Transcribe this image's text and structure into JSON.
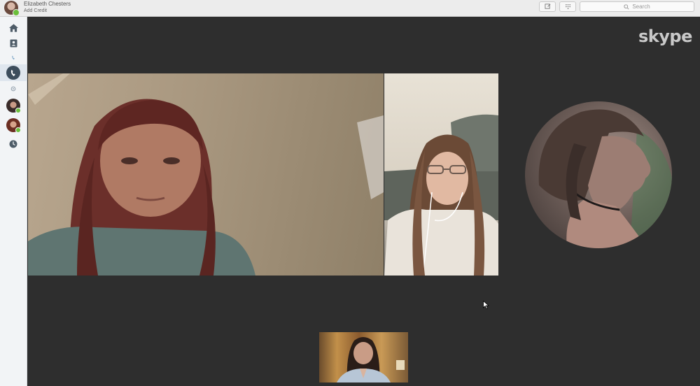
{
  "profile": {
    "name": "Elizabeth Chesters",
    "credit_link": "Add Credit"
  },
  "search": {
    "placeholder": "Search"
  },
  "brand": {
    "logo_text": "skype"
  },
  "colors": {
    "presence_online": "#6bbf3a",
    "stage_background": "#2e2e2e",
    "sidebar_background": "#f2f4f6"
  },
  "sidebar": {
    "items": [
      {
        "icon": "home-icon"
      },
      {
        "icon": "contacts-icon"
      },
      {
        "icon": "dialpad-icon"
      },
      {
        "icon": "call-icon",
        "active": true
      },
      {
        "icon": "settings-icon"
      },
      {
        "icon": "contact-avatar",
        "online": true
      },
      {
        "icon": "contact-avatar",
        "online": true
      },
      {
        "icon": "recent-icon"
      }
    ]
  },
  "call": {
    "participants": [
      {
        "role": "main-video"
      },
      {
        "role": "side-video"
      },
      {
        "role": "circular-video"
      },
      {
        "role": "self-preview"
      }
    ]
  }
}
